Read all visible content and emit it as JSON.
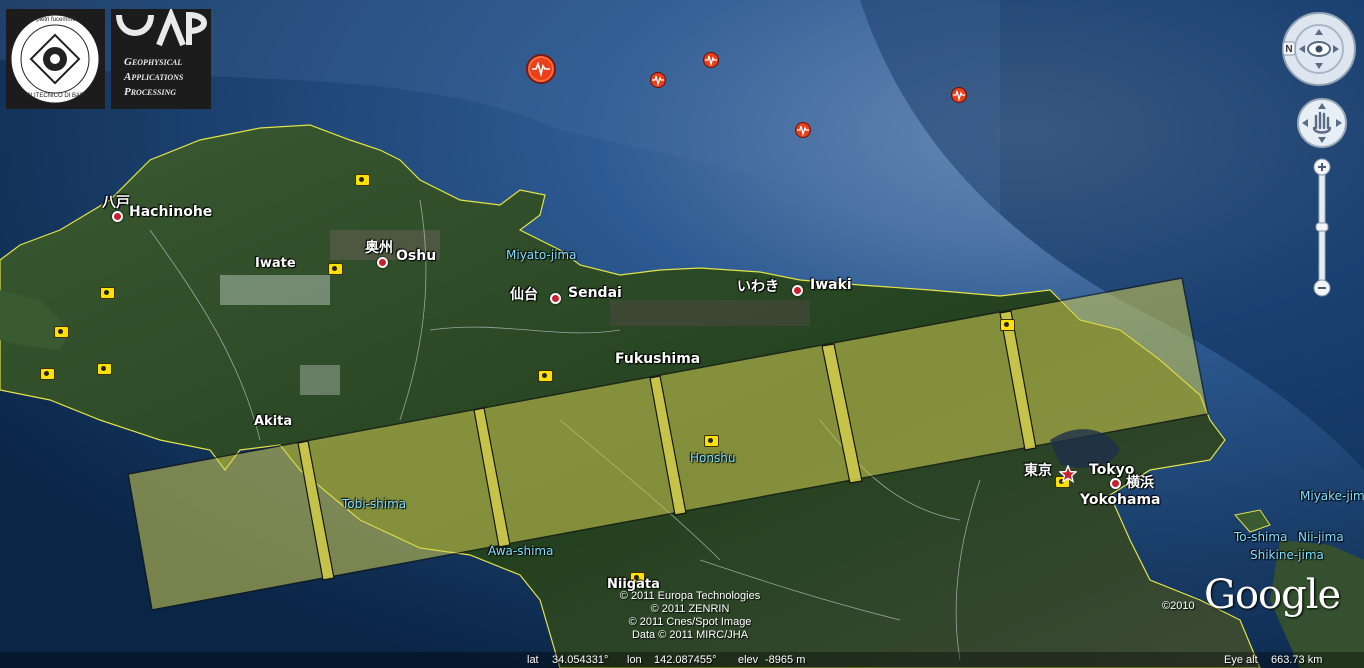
{
  "logos": {
    "polimi_motto": "de pietri fucemmo all",
    "polimi_name": "POLITECNICO DI BARI",
    "gap_line1": "Geophysical",
    "gap_line2": "Applications",
    "gap_line3": "Processing"
  },
  "labels": {
    "hachinohe_jp": "八戸",
    "hachinohe": "Hachinohe",
    "oshu_jp": "奥州",
    "oshu": "Oshu",
    "iwate": "Iwate",
    "miyato": "Miyato-jima",
    "sendai_jp": "仙台",
    "sendai": "Sendai",
    "iwaki_jp": "いわき",
    "iwaki": "Iwaki",
    "fukushima": "Fukushima",
    "akita": "Akita",
    "honshu": "Honshu",
    "tobishima": "Tobi-shima",
    "awashima": "Awa-shima",
    "niigata": "Niigata",
    "tokyo_jp": "東京",
    "tokyo": "Tokyo",
    "yokohama_jp": "横浜",
    "yokohama": "Yokohama",
    "miyake": "Miyake-jima",
    "toshima": "To-shima",
    "niijima": "Nii-jima",
    "shikine": "Shikine-jima"
  },
  "copyright": [
    "© 2011 Europa Technologies",
    "© 2011 ZENRIN",
    "© 2011 Cnes/Spot Image",
    "Data © 2011 MIRC/JHA"
  ],
  "google": {
    "logo": "Google",
    "year": "©2010"
  },
  "status": {
    "lat_label": "lat",
    "lat": "34.054331°",
    "lon_label": "lon",
    "lon": "142.087455°",
    "elev_label": "elev",
    "elev": "-8965 m",
    "eye_label": "Eye alt",
    "eye": "663.73 km"
  },
  "nav": {
    "north": "N"
  },
  "colors": {
    "ocean": "#0b2747",
    "land": "#2c4a26",
    "swath": "#c7c34a",
    "quake": "#e8401a"
  },
  "icons": [
    "compass-icon",
    "pan-hand-icon",
    "zoom-in-icon",
    "zoom-out-icon",
    "earthquake-icon",
    "photo-icon",
    "city-marker-icon",
    "star-icon"
  ]
}
